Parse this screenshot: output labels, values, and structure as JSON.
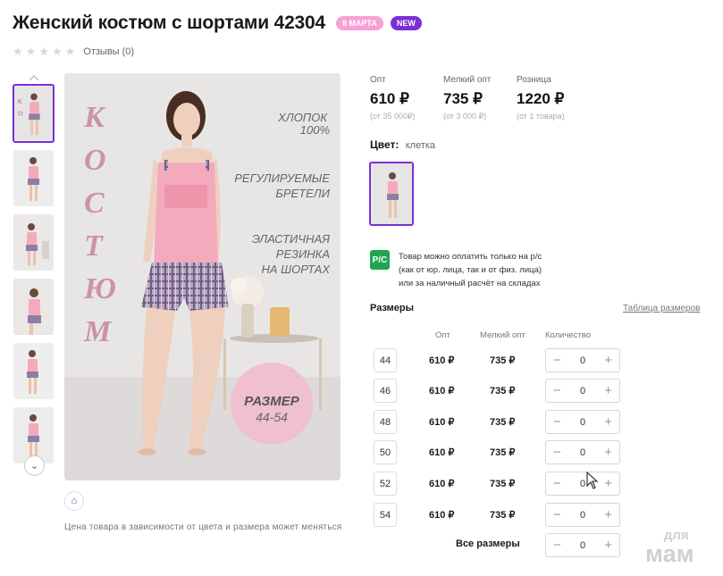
{
  "product": {
    "title": "Женский костюм с шортами 42304",
    "badges": {
      "march": "8 МАРТА",
      "new": "NEW"
    },
    "reviews": "Отзывы (0)",
    "rating_stars": 0
  },
  "gallery": {
    "image_text": {
      "vertical_title": [
        "К",
        "О",
        "С",
        "Т",
        "Ю",
        "М"
      ],
      "line1": "ХЛОПОК",
      "line2": "100%",
      "line3": "РЕГУЛИРУЕМЫЕ",
      "line4": "БРЕТЕЛИ",
      "line5": "ЭЛАСТИЧНАЯ",
      "line6": "РЕЗИНКА",
      "line7": "НА ШОРТАХ",
      "size_label": "РАЗМЕР",
      "size_range": "44-54"
    },
    "price_note": "Цена товара в зависимости от цвета и размера может меняться"
  },
  "prices": [
    {
      "label": "Опт",
      "value": "610 ₽",
      "sub": "(от 35 000₽)"
    },
    {
      "label": "Мелкий опт",
      "value": "735 ₽",
      "sub": "(от 3 000 ₽)"
    },
    {
      "label": "Розница",
      "value": "1220 ₽",
      "sub": "(от 1 товара)"
    }
  ],
  "color": {
    "label": "Цвет:",
    "value": "клетка"
  },
  "payment": {
    "icon_text": "P/C",
    "lines": [
      "Товар можно оплатить только на р/с",
      "(как от юр. лица, так и от физ. лица)",
      "или за наличный расчёт на складах"
    ]
  },
  "sizes": {
    "title": "Размеры",
    "table_link": "Таблица размеров",
    "headers": {
      "opt": "Опт",
      "small_opt": "Мелкий опт",
      "quantity": "Количество"
    },
    "rows": [
      {
        "size": "44",
        "opt": "610 ₽",
        "small_opt": "735 ₽",
        "qty": "0"
      },
      {
        "size": "46",
        "opt": "610 ₽",
        "small_opt": "735 ₽",
        "qty": "0"
      },
      {
        "size": "48",
        "opt": "610 ₽",
        "small_opt": "735 ₽",
        "qty": "0"
      },
      {
        "size": "50",
        "opt": "610 ₽",
        "small_opt": "735 ₽",
        "qty": "0"
      },
      {
        "size": "52",
        "opt": "610 ₽",
        "small_opt": "735 ₽",
        "qty": "0"
      },
      {
        "size": "54",
        "opt": "610 ₽",
        "small_opt": "735 ₽",
        "qty": "0"
      }
    ],
    "all_sizes_label": "Все размеры",
    "all_sizes_qty": "0"
  },
  "watermark": {
    "top": "для",
    "bottom": "мам"
  },
  "colors": {
    "accent": "#7b2fd6",
    "badge_march": "#f7a0d6",
    "pay_icon": "#1ea650",
    "outfit_pink": "#f4a9bd"
  }
}
